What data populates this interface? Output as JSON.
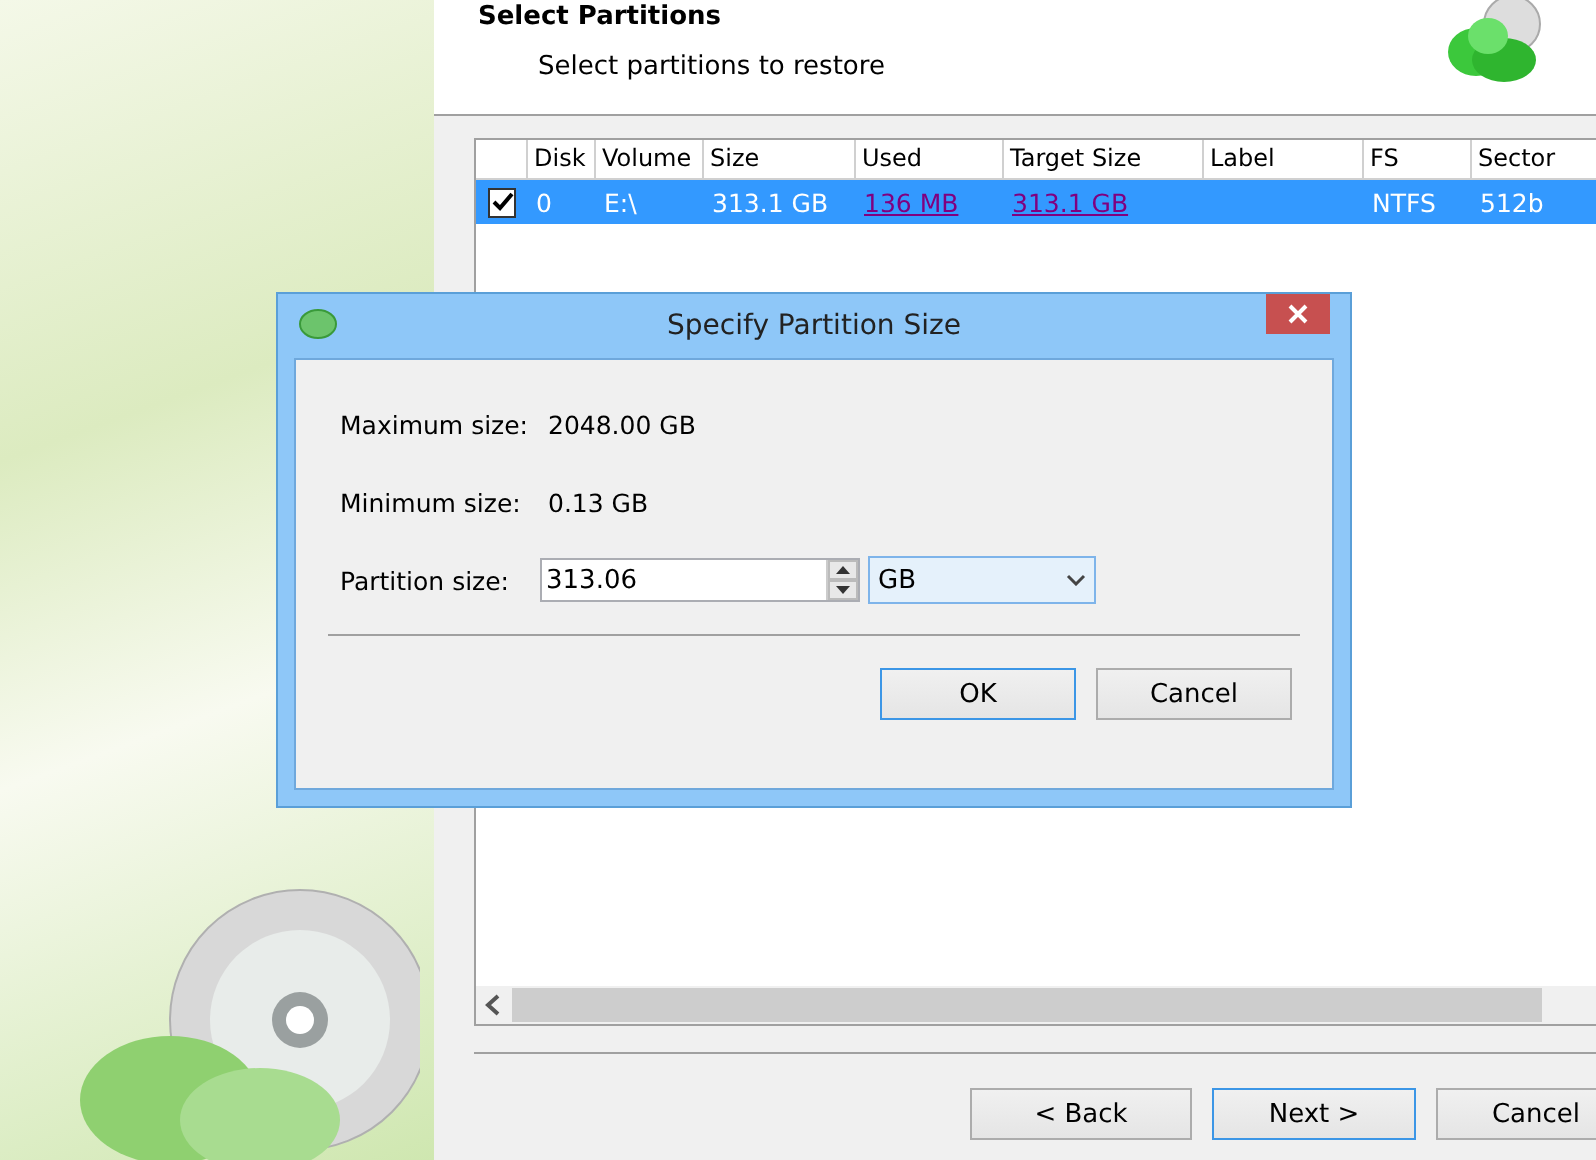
{
  "header": {
    "title": "Select Partitions",
    "subtitle": "Select partitions to restore"
  },
  "table": {
    "columns": [
      "Disk",
      "Volume",
      "Size",
      "Used",
      "Target Size",
      "Label",
      "FS",
      "Sector"
    ],
    "rows": [
      {
        "checked": true,
        "selected": true,
        "cells": [
          "0",
          "E:\\",
          "313.1 GB",
          "136 MB",
          "313.1 GB",
          "",
          "NTFS",
          "512b"
        ]
      }
    ]
  },
  "footer": {
    "buttons": [
      "< Back",
      "Next >",
      "Cancel"
    ]
  },
  "dialog": {
    "title": "Specify Partition Size",
    "maximum_label": "Maximum size:",
    "maximum_value": "2048.00 GB",
    "minimum_label": "Minimum size:",
    "minimum_value": "0.13 GB",
    "size_label": "Partition size:",
    "size_value": "313.06",
    "unit": "GB",
    "buttons": [
      "OK",
      "Cancel"
    ]
  }
}
